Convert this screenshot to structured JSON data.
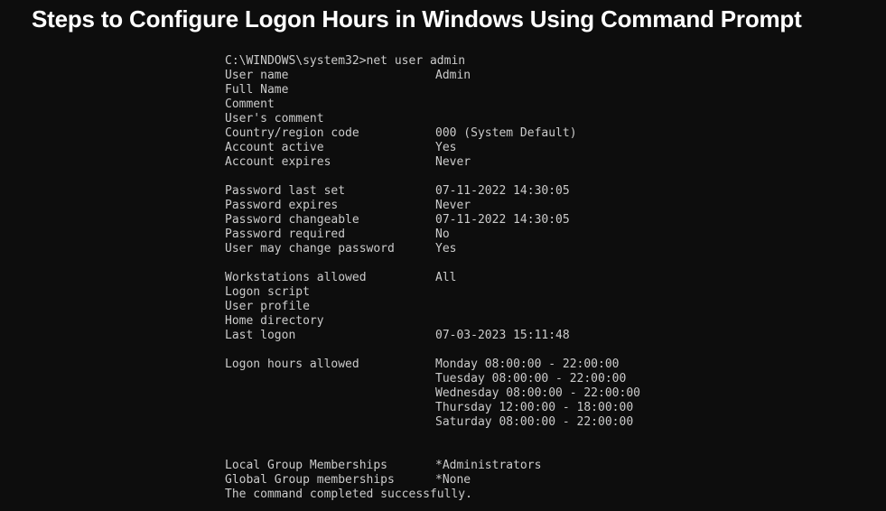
{
  "title": "Steps to Configure Logon Hours in Windows Using Command Prompt",
  "colors": {
    "background": "#0d0d0d",
    "title_text": "#ffffff",
    "console_text": "#cbcbcb"
  },
  "console": {
    "prompt_line": "C:\\WINDOWS\\system32>net user admin",
    "lines": [
      {
        "kind": "raw",
        "text": "C:\\WINDOWS\\system32>net user admin"
      },
      {
        "kind": "pair",
        "label": "User name",
        "value": "Admin"
      },
      {
        "kind": "pair",
        "label": "Full Name",
        "value": ""
      },
      {
        "kind": "pair",
        "label": "Comment",
        "value": ""
      },
      {
        "kind": "pair",
        "label": "User's comment",
        "value": ""
      },
      {
        "kind": "pair",
        "label": "Country/region code",
        "value": "000 (System Default)"
      },
      {
        "kind": "pair",
        "label": "Account active",
        "value": "Yes"
      },
      {
        "kind": "pair",
        "label": "Account expires",
        "value": "Never"
      },
      {
        "kind": "blank",
        "text": ""
      },
      {
        "kind": "pair",
        "label": "Password last set",
        "value": "07-11-2022 14:30:05"
      },
      {
        "kind": "pair",
        "label": "Password expires",
        "value": "Never"
      },
      {
        "kind": "pair",
        "label": "Password changeable",
        "value": "07-11-2022 14:30:05"
      },
      {
        "kind": "pair",
        "label": "Password required",
        "value": "No"
      },
      {
        "kind": "pair",
        "label": "User may change password",
        "value": "Yes"
      },
      {
        "kind": "blank",
        "text": ""
      },
      {
        "kind": "pair",
        "label": "Workstations allowed",
        "value": "All"
      },
      {
        "kind": "pair",
        "label": "Logon script",
        "value": ""
      },
      {
        "kind": "pair",
        "label": "User profile",
        "value": ""
      },
      {
        "kind": "pair",
        "label": "Home directory",
        "value": ""
      },
      {
        "kind": "pair",
        "label": "Last logon",
        "value": "07-03-2023 15:11:48"
      },
      {
        "kind": "blank",
        "text": ""
      },
      {
        "kind": "pair",
        "label": "Logon hours allowed",
        "value": "Monday 08:00:00 - 22:00:00"
      },
      {
        "kind": "pair",
        "label": "",
        "value": "Tuesday 08:00:00 - 22:00:00"
      },
      {
        "kind": "pair",
        "label": "",
        "value": "Wednesday 08:00:00 - 22:00:00"
      },
      {
        "kind": "pair",
        "label": "",
        "value": "Thursday 12:00:00 - 18:00:00"
      },
      {
        "kind": "pair",
        "label": "",
        "value": "Saturday 08:00:00 - 22:00:00"
      },
      {
        "kind": "blank",
        "text": ""
      },
      {
        "kind": "blank",
        "text": ""
      },
      {
        "kind": "pair",
        "label": "Local Group Memberships",
        "value": "*Administrators"
      },
      {
        "kind": "pair",
        "label": "Global Group memberships",
        "value": "*None"
      },
      {
        "kind": "raw",
        "text": "The command completed successfully."
      }
    ],
    "logon_hours": [
      {
        "day": "Monday",
        "start": "08:00:00",
        "end": "22:00:00"
      },
      {
        "day": "Tuesday",
        "start": "08:00:00",
        "end": "22:00:00"
      },
      {
        "day": "Wednesday",
        "start": "08:00:00",
        "end": "22:00:00"
      },
      {
        "day": "Thursday",
        "start": "12:00:00",
        "end": "18:00:00"
      },
      {
        "day": "Saturday",
        "start": "08:00:00",
        "end": "22:00:00"
      }
    ]
  }
}
